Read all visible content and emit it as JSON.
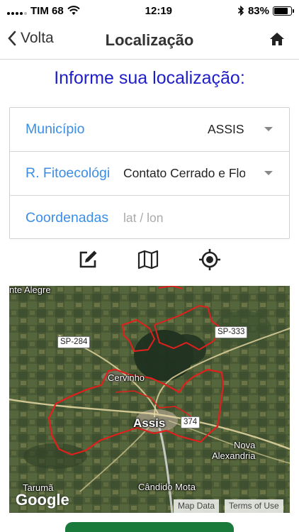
{
  "status_bar": {
    "carrier": "TIM 68",
    "time": "12:19",
    "battery_percent": "83%",
    "battery_level": 0.83
  },
  "nav": {
    "back_label": "Volta",
    "title": "Localização"
  },
  "section_title": "Informe sua localização:",
  "form": {
    "municipio": {
      "label": "Município",
      "value": "ASSIS"
    },
    "fitoecologica": {
      "label": "R. Fitoecológica",
      "value": "Contato Cerrado e Floresta"
    },
    "coordenadas": {
      "label": "Coordenadas",
      "placeholder": "lat / lon",
      "value": ""
    }
  },
  "tools": [
    "edit-icon",
    "map-icon",
    "gps-icon"
  ],
  "map": {
    "places": {
      "monte_alegre": "nte Alegre",
      "cervinho": "Cervinho",
      "assis": "Assis",
      "nova_alexandria_1": "Nova",
      "nova_alexandria_2": "Alexandria",
      "tarumã": "Tarumã",
      "candido_mota": "Cândido Mota"
    },
    "roads": {
      "sp284": "SP-284",
      "sp333": "SP-333",
      "r374": "374"
    },
    "logo": "Google",
    "attribution_map": "Map Data",
    "attribution_terms": "Terms of Use",
    "boundary_color": "#e0201c"
  },
  "colors": {
    "accent_label": "#3a8ee6",
    "title_blue": "#1e1ec8",
    "button_green": "#1a7a3c"
  }
}
